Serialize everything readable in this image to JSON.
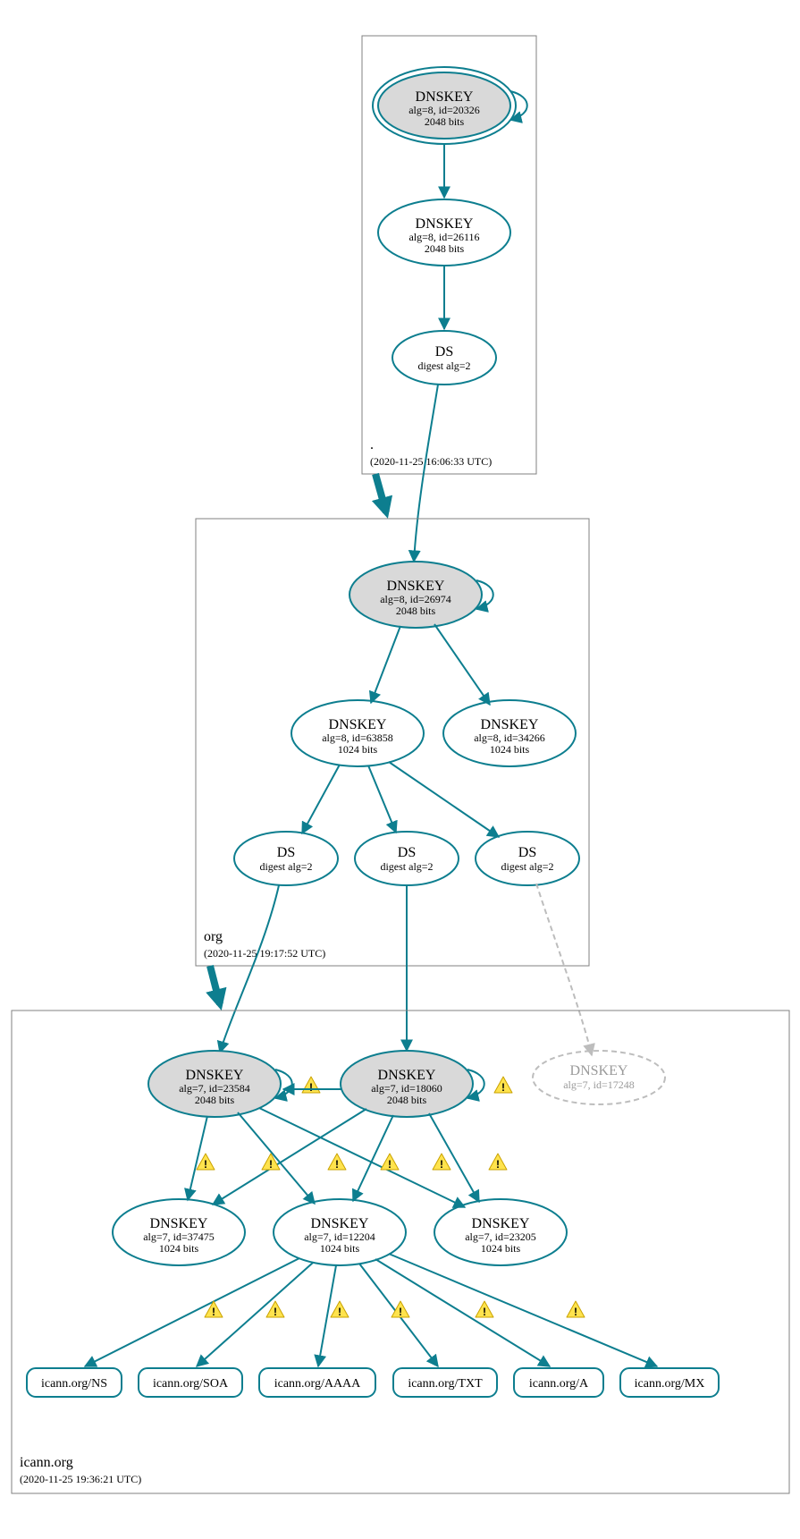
{
  "zones": {
    "root": {
      "name": ".",
      "timestamp": "(2020-11-25 16:06:33 UTC)"
    },
    "org": {
      "name": "org",
      "timestamp": "(2020-11-25 19:17:52 UTC)"
    },
    "icann": {
      "name": "icann.org",
      "timestamp": "(2020-11-25 19:36:21 UTC)"
    }
  },
  "nodes": {
    "root_ksk": {
      "title": "DNSKEY",
      "sub1": "alg=8, id=20326",
      "sub2": "2048 bits"
    },
    "root_zsk": {
      "title": "DNSKEY",
      "sub1": "alg=8, id=26116",
      "sub2": "2048 bits"
    },
    "root_ds": {
      "title": "DS",
      "sub1": "digest alg=2"
    },
    "org_ksk": {
      "title": "DNSKEY",
      "sub1": "alg=8, id=26974",
      "sub2": "2048 bits"
    },
    "org_zsk1": {
      "title": "DNSKEY",
      "sub1": "alg=8, id=63858",
      "sub2": "1024 bits"
    },
    "org_zsk2": {
      "title": "DNSKEY",
      "sub1": "alg=8, id=34266",
      "sub2": "1024 bits"
    },
    "org_ds1": {
      "title": "DS",
      "sub1": "digest alg=2"
    },
    "org_ds2": {
      "title": "DS",
      "sub1": "digest alg=2"
    },
    "org_ds3": {
      "title": "DS",
      "sub1": "digest alg=2"
    },
    "ic_ksk1": {
      "title": "DNSKEY",
      "sub1": "alg=7, id=23584",
      "sub2": "2048 bits"
    },
    "ic_ksk2": {
      "title": "DNSKEY",
      "sub1": "alg=7, id=18060",
      "sub2": "2048 bits"
    },
    "ic_kmiss": {
      "title": "DNSKEY",
      "sub1": "alg=7, id=17248"
    },
    "ic_zsk1": {
      "title": "DNSKEY",
      "sub1": "alg=7, id=37475",
      "sub2": "1024 bits"
    },
    "ic_zsk2": {
      "title": "DNSKEY",
      "sub1": "alg=7, id=12204",
      "sub2": "1024 bits"
    },
    "ic_zsk3": {
      "title": "DNSKEY",
      "sub1": "alg=7, id=23205",
      "sub2": "1024 bits"
    }
  },
  "records": {
    "r_ns": "icann.org/NS",
    "r_soa": "icann.org/SOA",
    "r_aaaa": "icann.org/AAAA",
    "r_txt": "icann.org/TXT",
    "r_a": "icann.org/A",
    "r_mx": "icann.org/MX"
  }
}
